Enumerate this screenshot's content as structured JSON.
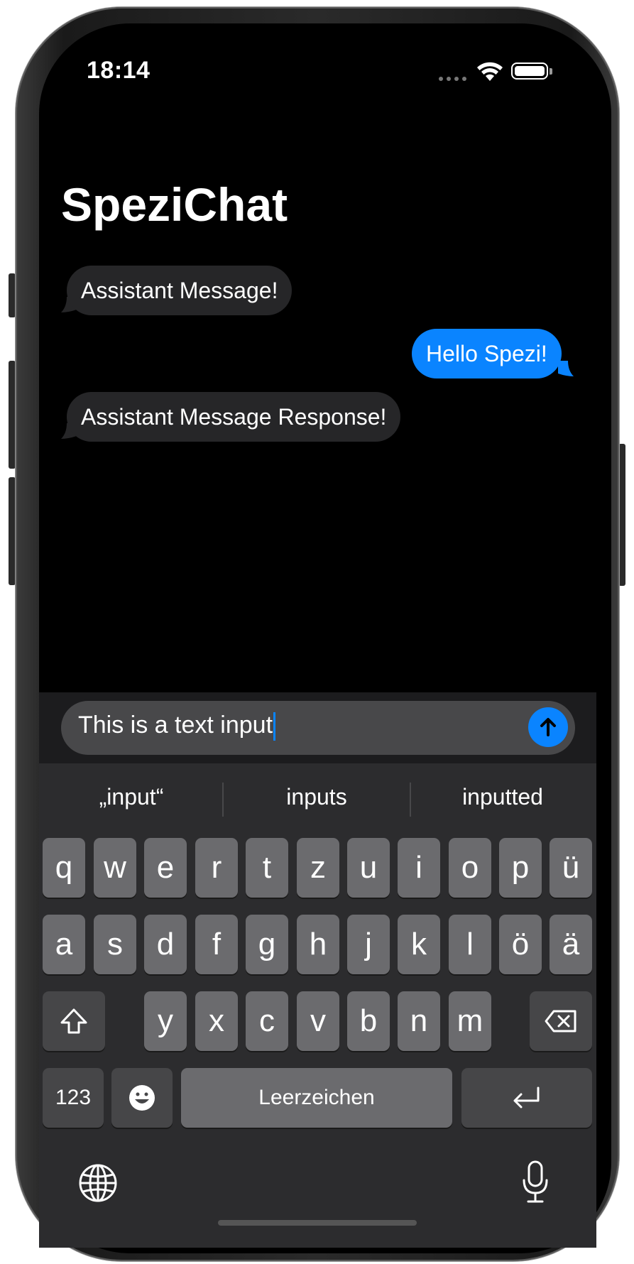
{
  "status_bar": {
    "time": "18:14"
  },
  "page_title": "SpeziChat",
  "messages": [
    {
      "role": "assistant",
      "text": "Assistant Message!"
    },
    {
      "role": "user",
      "text": "Hello Spezi!"
    },
    {
      "role": "assistant",
      "text": "Assistant Message Response!"
    }
  ],
  "input": {
    "value": "This is a text input"
  },
  "suggestions": [
    "„input“",
    "inputs",
    "inputted"
  ],
  "keyboard": {
    "row1": [
      "q",
      "w",
      "e",
      "r",
      "t",
      "z",
      "u",
      "i",
      "o",
      "p",
      "ü"
    ],
    "row2": [
      "a",
      "s",
      "d",
      "f",
      "g",
      "h",
      "j",
      "k",
      "l",
      "ö",
      "ä"
    ],
    "row3": [
      "y",
      "x",
      "c",
      "v",
      "b",
      "n",
      "m"
    ],
    "numbers_label": "123",
    "space_label": "Leerzeichen"
  },
  "colors": {
    "accent": "#0a84ff",
    "assistant_bubble": "#262628",
    "background": "#000000"
  },
  "icons": [
    "wifi-icon",
    "battery-icon",
    "send-arrow-icon",
    "shift-icon",
    "delete-icon",
    "emoji-icon",
    "return-icon",
    "globe-icon",
    "microphone-icon"
  ]
}
